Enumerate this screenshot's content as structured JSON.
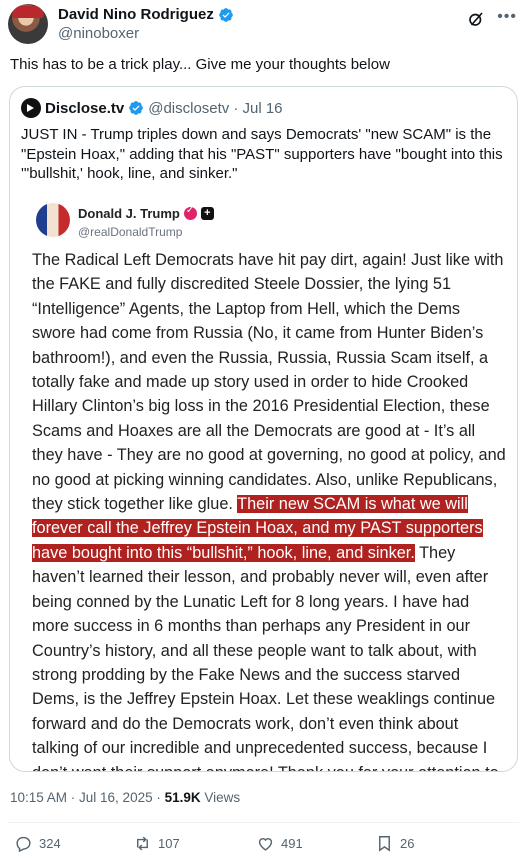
{
  "author": {
    "name": "David Nino Rodriguez",
    "handle": "@ninoboxer"
  },
  "tweet": {
    "text": "This has to be a trick play... Give me your thoughts below"
  },
  "quoted": {
    "name": "Disclose.tv",
    "handle": "@disclosetv",
    "date": "· Jul 16",
    "text": "JUST IN - Trump triples down and says Democrats' \"new SCAM\" is the \"Epstein Hoax,\" adding that his \"PAST\" supporters have \"bought into this '\"bullshit,' hook, line, and sinker.\"",
    "embed": {
      "name": "Donald J. Trump",
      "handle": "@realDonaldTrump",
      "body_before": "The Radical Left Democrats have hit pay dirt, again! Just like with the FAKE and fully discredited Steele Dossier, the lying 51 “Intelligence” Agents, the Laptop from Hell, which the Dems swore had come from Russia (No, it came from Hunter Biden’s bathroom!), and even the Russia, Russia, Russia Scam itself, a totally fake and made up story used in order to hide Crooked Hillary Clinton’s big loss in the 2016 Presidential Election, these Scams and Hoaxes are all the Democrats are good at - It’s all they have - They are no good at governing, no good at policy, and no good at picking winning candidates. Also, unlike Republicans, they stick together like glue. ",
      "body_highlight": "Their new SCAM is what we will forever call the Jeffrey Epstein Hoax, and my PAST supporters have bought into this “bullshit,” hook, line, and sinker.",
      "body_after": " They haven’t learned their lesson, and probably never will, even after being conned by the Lunatic Left for 8 long years. I have had more success in 6 months than perhaps any President in our Country’s history, and all these people want to talk about, with strong prodding by the Fake News and the success starved Dems, is the Jeffrey Epstein Hoax. Let these weaklings continue forward and do the Democrats work, don’t even think about talking of our incredible and unprecedented success, because I don’t want their support anymore! Thank you for your attention to this matter. MAKE AMERICA GREAT AGAIN!",
      "highlight_color": "#b0221f"
    }
  },
  "meta": {
    "time": "10:15 AM · Jul 16, 2025 · ",
    "views_count": "51.9K",
    "views_label": " Views"
  },
  "actions": {
    "replies": "324",
    "reposts": "107",
    "likes": "491",
    "bookmarks": "26"
  },
  "icons": [
    "verified-icon",
    "grok-icon",
    "more-icon",
    "reply-icon",
    "repost-icon",
    "like-icon",
    "bookmark-icon"
  ],
  "colors": {
    "accent": "#1d9bf0",
    "secondary_text": "#536471",
    "border": "#cfd9de"
  }
}
